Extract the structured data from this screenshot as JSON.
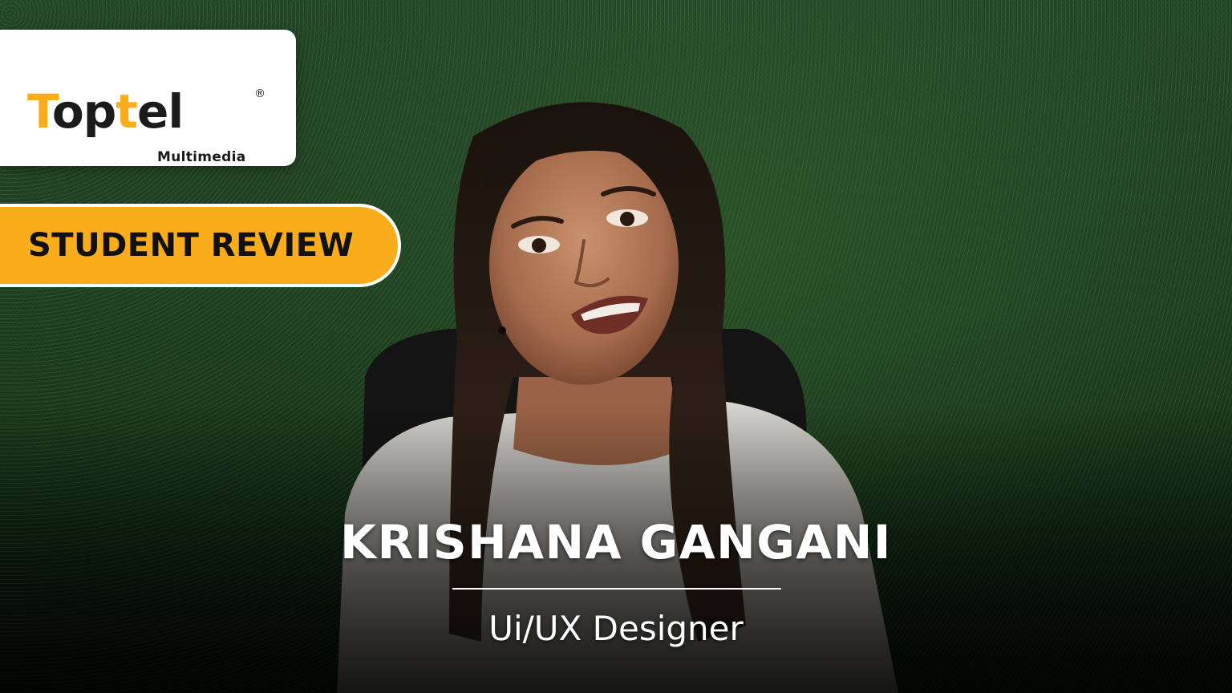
{
  "brand": {
    "name": "Toptel",
    "registered_mark": "®",
    "tagline": "Multimedia",
    "colors": {
      "dark": "#1b1b1b",
      "accent": "#f9ad1d"
    }
  },
  "badge": {
    "label": "STUDENT REVIEW",
    "color": "#f9ad1d"
  },
  "person": {
    "name": "KRISHANA GANGANI",
    "role": "Ui/UX Designer"
  }
}
